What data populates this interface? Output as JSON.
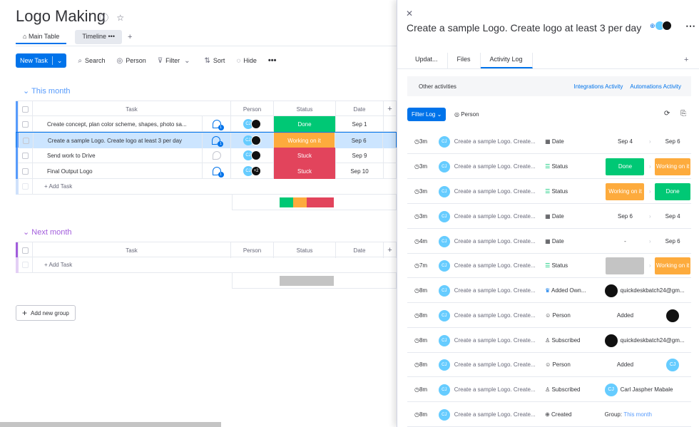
{
  "board": {
    "title": "Logo Making",
    "tabs": [
      {
        "label": "Main Table"
      },
      {
        "label": "Timeline"
      }
    ],
    "tab_add": "+",
    "toolbar": {
      "new_task": "New Task",
      "search": "Search",
      "person": "Person",
      "filter": "Filter",
      "sort": "Sort",
      "hide": "Hide"
    },
    "columns": {
      "task": "Task",
      "person": "Person",
      "status": "Status",
      "date": "Date"
    },
    "groups": [
      {
        "title": "This month",
        "color": "#579bfc",
        "rows": [
          {
            "task": "Create concept, plan color scheme, shapes, photo sa...",
            "updates": "1",
            "person_extra": "",
            "status": "Done",
            "status_color": "#00c875",
            "date": "Sep 1"
          },
          {
            "task": "Create a sample Logo. Create logo at least 3 per day",
            "updates": "1",
            "person_extra": "",
            "status": "Working on it",
            "status_color": "#fdab3d",
            "date": "Sep 6"
          },
          {
            "task": "Send work to Drive",
            "updates": "",
            "person_extra": "",
            "status": "Stuck",
            "status_color": "#e2445c",
            "date": "Sep 9"
          },
          {
            "task": "Final Output Logo",
            "updates": "1",
            "person_extra": "+2",
            "status": "Stuck",
            "status_color": "#e2445c",
            "date": "Sep 10"
          }
        ],
        "add_label": "+ Add Task"
      },
      {
        "title": "Next month",
        "color": "#a25ddc",
        "rows": [],
        "add_label": "+ Add Task"
      }
    ],
    "add_group": "Add new group"
  },
  "panel": {
    "title": "Create a sample Logo. Create logo at least 3 per day",
    "tabs": [
      {
        "label": "Updat..."
      },
      {
        "label": "Files"
      },
      {
        "label": "Activity Log"
      }
    ],
    "other_activities": "Other activities",
    "integrations": "Integrations Activity",
    "automations": "Automations Activity",
    "filter_log": "Filter Log",
    "person": "Person",
    "avatar_initials": "CJ",
    "log": [
      {
        "time": "3m",
        "name": "Create a sample Logo. Create...",
        "field": "Date",
        "old": "Sep 4",
        "new": "Sep 6"
      },
      {
        "time": "3m",
        "name": "Create a sample Logo. Create...",
        "field": "Status",
        "old": "Done",
        "new": "Working on it"
      },
      {
        "time": "3m",
        "name": "Create a sample Logo. Create...",
        "field": "Status",
        "old": "Working on it",
        "new": "Done"
      },
      {
        "time": "3m",
        "name": "Create a sample Logo. Create...",
        "field": "Date",
        "old": "Sep 6",
        "new": "Sep 4"
      },
      {
        "time": "4m",
        "name": "Create a sample Logo. Create...",
        "field": "Date",
        "old": "-",
        "new": "Sep 6"
      },
      {
        "time": "7m",
        "name": "Create a sample Logo. Create...",
        "field": "Status",
        "old": "",
        "new": "Working on it"
      },
      {
        "time": "8m",
        "name": "Create a sample Logo. Create...",
        "field": "Added Own...",
        "value": "quickdeskbatch24@gm..."
      },
      {
        "time": "8m",
        "name": "Create a sample Logo. Create...",
        "field": "Person",
        "old": "Added",
        "new": ""
      },
      {
        "time": "8m",
        "name": "Create a sample Logo. Create...",
        "field": "Subscribed",
        "value": "quickdeskbatch24@gm..."
      },
      {
        "time": "8m",
        "name": "Create a sample Logo. Create...",
        "field": "Person",
        "old": "Added",
        "new": "CJ"
      },
      {
        "time": "8m",
        "name": "Create a sample Logo. Create...",
        "field": "Subscribed",
        "value": "Carl Jaspher Mabale"
      },
      {
        "time": "8m",
        "name": "Create a sample Logo. Create...",
        "field": "Created",
        "group_label": "Group:",
        "group_value": "This month"
      }
    ]
  }
}
